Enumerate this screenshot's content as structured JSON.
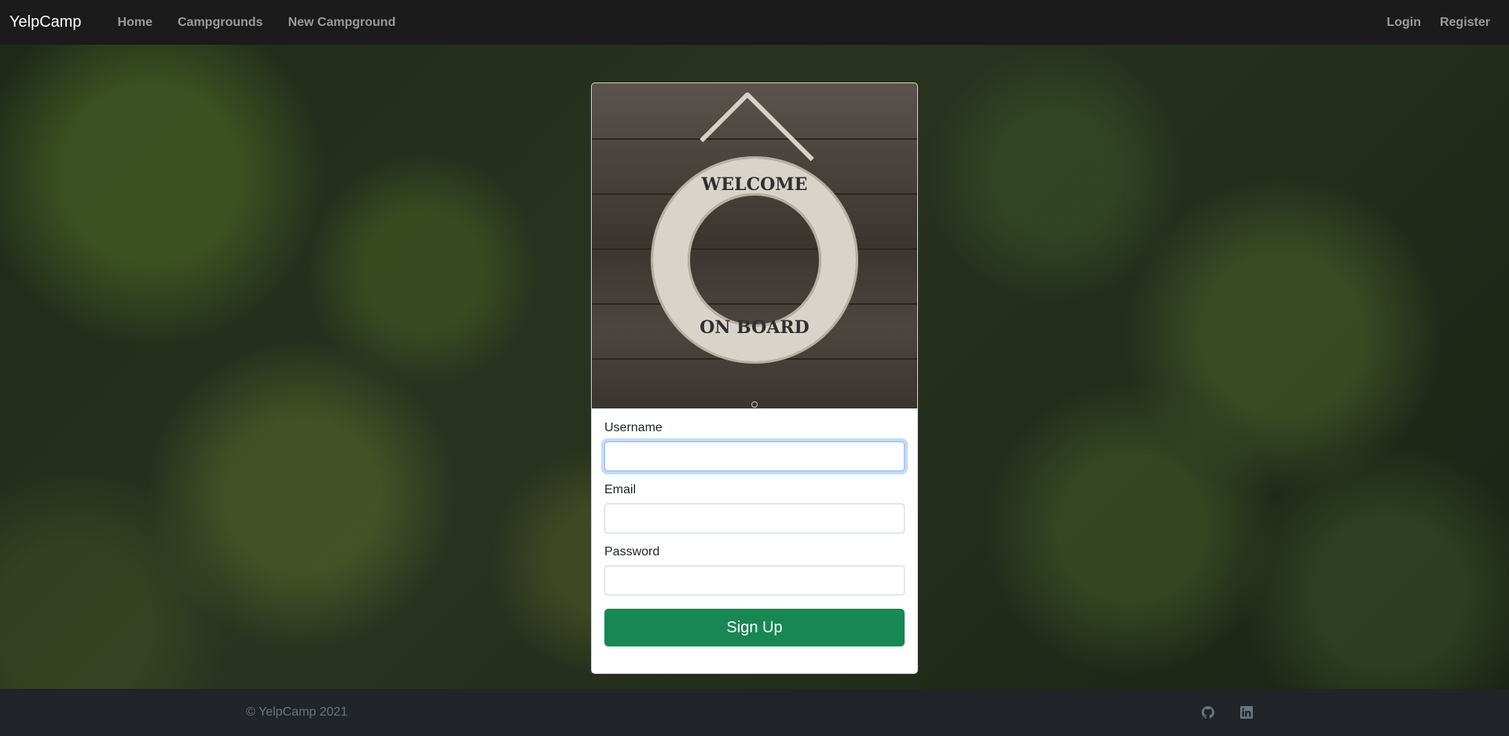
{
  "navbar": {
    "brand": "YelpCamp",
    "left_links": [
      "Home",
      "Campgrounds",
      "New Campground"
    ],
    "right_links": [
      "Login",
      "Register"
    ]
  },
  "card": {
    "image_text_top": "WELCOME",
    "image_text_bottom": "ON BOARD",
    "fields": {
      "username_label": "Username",
      "username_value": "",
      "email_label": "Email",
      "email_value": "",
      "password_label": "Password",
      "password_value": ""
    },
    "submit_label": "Sign Up"
  },
  "footer": {
    "copyright": "© YelpCamp 2021",
    "icons": [
      "github-icon",
      "linkedin-icon"
    ]
  },
  "colors": {
    "navbar_bg": "#1b1b1b",
    "footer_bg": "#212529",
    "primary_button": "#198754",
    "focus_ring": "#86b7fe"
  }
}
